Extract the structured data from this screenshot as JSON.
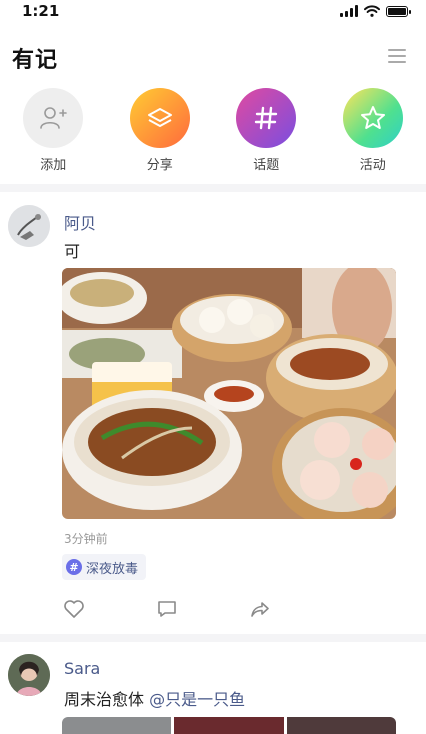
{
  "status_bar": {
    "time": "1:21",
    "icons": [
      "signal-icon",
      "wifi-icon",
      "battery-icon"
    ]
  },
  "header": {
    "title": "有记",
    "menu_icon": "menu-icon"
  },
  "actions": [
    {
      "label": "添加",
      "icon": "add-person-icon"
    },
    {
      "label": "分享",
      "icon": "layers-icon"
    },
    {
      "label": "话题",
      "icon": "hashtag-icon"
    },
    {
      "label": "活动",
      "icon": "star-icon"
    }
  ],
  "posts": [
    {
      "author": "阿贝",
      "text": "可",
      "time": "3分钟前",
      "tag": "深夜放毒",
      "photo": "dim-sum-photo",
      "action_icons": [
        "like-icon",
        "comment-icon",
        "share-icon"
      ]
    },
    {
      "author": "Sara",
      "text": "周末治愈体",
      "mention": "@只是一只鱼",
      "photo": "photo-strip"
    }
  ],
  "colors": {
    "author": "#4a5a8a",
    "tag_bg": "#f2f3f8",
    "divider": "#f4f4f6"
  }
}
